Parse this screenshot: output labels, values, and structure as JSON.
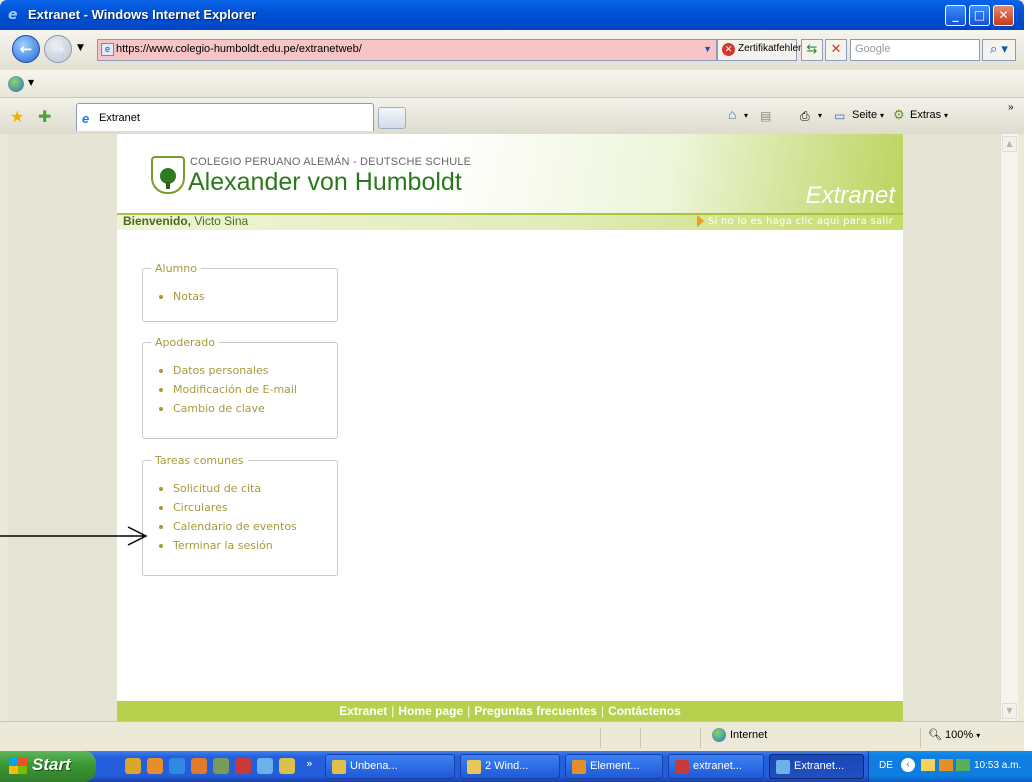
{
  "window": {
    "title": "Extranet - Windows Internet Explorer"
  },
  "address": {
    "url": "https://www.colegio-humboldt.edu.pe/extranetweb/",
    "cert_error": "Zertifikatfehler",
    "search_placeholder": "Google"
  },
  "tab": {
    "label": "Extranet"
  },
  "commandbar": {
    "page": "Seite",
    "extras": "Extras"
  },
  "header": {
    "school_line": "COLEGIO PERUANO ALEMÁN - DEUTSCHE SCHULE",
    "school_name": "Alexander von Humboldt",
    "extranet": "Extranet",
    "welcome_label": "Bienvenido,",
    "welcome_user": "Victo Sina",
    "logout": "Si no lo es haga clic aqui para salir"
  },
  "sections": [
    {
      "title": "Alumno",
      "items": [
        "Notas"
      ]
    },
    {
      "title": "Apoderado",
      "items": [
        "Datos personales",
        "Modificación de E-mail",
        "Cambio de clave"
      ]
    },
    {
      "title": "Tareas comunes",
      "items": [
        "Solicitud de cita",
        "Circulares",
        "Calendario de eventos",
        "Terminar la sesión"
      ]
    }
  ],
  "footer": {
    "links": [
      "Extranet",
      "Home page",
      "Preguntas frecuentes",
      "Contáctenos"
    ]
  },
  "status": {
    "zone": "Internet",
    "zoom": "100%"
  },
  "taskbar": {
    "start": "Start",
    "tasks": [
      "Unbena...",
      "2 Wind...",
      "Element...",
      "extranet...",
      "Extranet..."
    ],
    "lang": "DE",
    "clock": "10:53 a.m."
  },
  "colors": {
    "accent_green": "#b7d14e",
    "link_olive": "#a79a3a",
    "school_green": "#2a7a1c",
    "url_error_bg": "#f7c5c5",
    "xp_blue": "#245edb"
  }
}
